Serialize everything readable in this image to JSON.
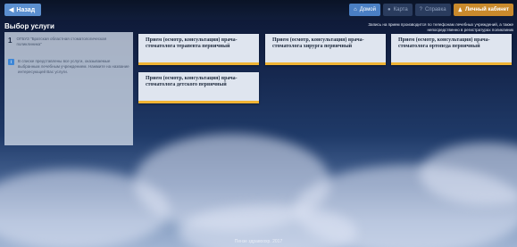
{
  "topbar": {
    "back_label": "Назад",
    "buttons": [
      {
        "label": "Домой",
        "icon": "home-icon",
        "active": true
      },
      {
        "label": "Карта",
        "icon": "globe-icon",
        "active": false
      },
      {
        "label": "Справка",
        "icon": "question-icon",
        "active": false
      },
      {
        "label": "Личный кабинет",
        "icon": "user-icon",
        "active": true
      }
    ]
  },
  "page": {
    "title": "Выбор услуги",
    "notice": "Запись на прием производится по телефонам лечебных учреждений, а также непосредственно в регистратурах поликлиник"
  },
  "sidebar": {
    "step_number": "1",
    "step_text": "ОГБУЗ \"Братская областная стоматологическая поликлиника\"",
    "info_text": "В списке представлены все услуги, оказываемые выбранным лечебным учреждением. Нажмите на название интересующей Вас услуги."
  },
  "services": [
    {
      "label": "Прием (осмотр, консультация) врача-стоматолога терапевта первичный"
    },
    {
      "label": "Прием (осмотр, консультация) врача-стоматолога хирурга первичный"
    },
    {
      "label": "Прием (осмотр, консультация) врача-стоматолога ортопеда первичный"
    },
    {
      "label": "Прием (осмотр, консультация) врача-стоматолога детского первичный"
    }
  ],
  "footer": {
    "text": "Пензе здравоохр. 2017"
  }
}
